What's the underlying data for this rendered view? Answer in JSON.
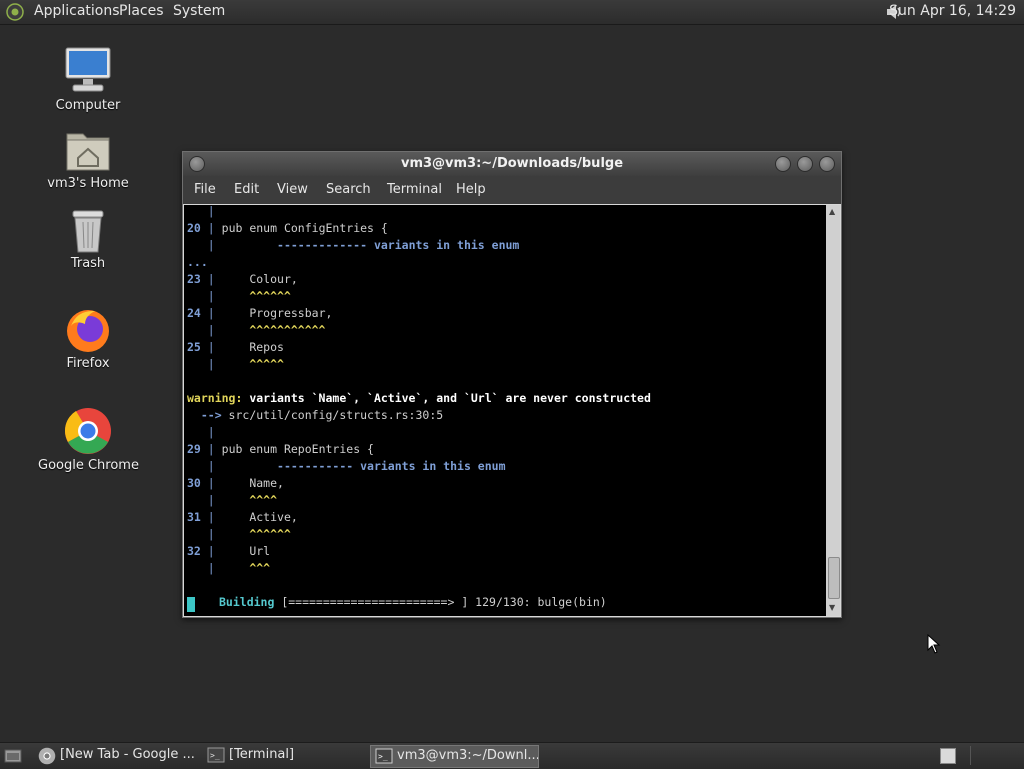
{
  "top_panel": {
    "menus": [
      "Applications",
      "Places",
      "System"
    ],
    "clock": "Sun Apr 16, 14:29",
    "icons": {
      "logo": "gnome-foot-icon",
      "volume": "speaker-icon"
    }
  },
  "desktop": {
    "icons": [
      {
        "label": "Computer",
        "icon": "computer-icon"
      },
      {
        "label": "vm3's Home",
        "icon": "home-folder-icon"
      },
      {
        "label": "Trash",
        "icon": "trash-icon"
      },
      {
        "label": "Firefox",
        "icon": "firefox-icon"
      },
      {
        "label": "Google Chrome",
        "icon": "chrome-icon"
      }
    ]
  },
  "window": {
    "title": "vm3@vm3:~/Downloads/bulge",
    "menu": [
      "File",
      "Edit",
      "View",
      "Search",
      "Terminal",
      "Help"
    ],
    "terminal": {
      "lines": {
        "l0_bar": "   |",
        "l1_num": "20",
        "l1_bar": " | ",
        "l1_code": "pub enum ConfigEntries {",
        "l2_bar": "   | ",
        "l2_pad": "        ",
        "l2_hint": "------------- variants in this enum",
        "l3": "...",
        "l4_num": "23",
        "l4_bar": " | ",
        "l4_code": "    Colour,",
        "l5_bar": "   | ",
        "l5_mark": "    ^^^^^^",
        "l6_num": "24",
        "l6_bar": " | ",
        "l6_code": "    Progressbar,",
        "l7_bar": "   | ",
        "l7_mark": "    ^^^^^^^^^^^",
        "l8_num": "25",
        "l8_bar": " | ",
        "l8_code": "    Repos",
        "l9_bar": "   | ",
        "l9_mark": "    ^^^^^",
        "l11_warn": "warning:",
        "l11_msg": " variants `Name`, `Active`, and `Url` are never constructed",
        "l12_arrow": "  --> ",
        "l12_path": "src/util/config/structs.rs:30:5",
        "l13_bar": "   |",
        "l14_num": "29",
        "l14_bar": " | ",
        "l14_code": "pub enum RepoEntries {",
        "l15_bar": "   | ",
        "l15_pad": "        ",
        "l15_hint": "----------- variants in this enum",
        "l16_num": "30",
        "l16_bar": " | ",
        "l16_code": "    Name,",
        "l17_bar": "   | ",
        "l17_mark": "    ^^^^",
        "l18_num": "31",
        "l18_bar": " | ",
        "l18_code": "    Active,",
        "l19_bar": "   | ",
        "l19_mark": "    ^^^^^^",
        "l20_num": "32",
        "l20_bar": " | ",
        "l20_code": "    Url",
        "l21_bar": "   | ",
        "l21_mark": "    ^^^",
        "l23_label": "Building",
        "l23_progress": " [=======================> ] 129/130: bulge(bin)"
      }
    }
  },
  "taskbar": {
    "tasks": [
      {
        "label": "[New Tab - Google ...",
        "icon": "chrome-icon"
      },
      {
        "label": "[Terminal]",
        "icon": "terminal-icon"
      },
      {
        "label": "vm3@vm3:~/Downl...",
        "icon": "terminal-icon"
      }
    ]
  }
}
